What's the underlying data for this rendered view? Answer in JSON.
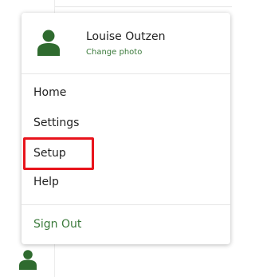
{
  "profile": {
    "name": "Louise Outzen",
    "change_photo": "Change photo"
  },
  "menu": {
    "home": "Home",
    "settings": "Settings",
    "setup": "Setup",
    "help": "Help",
    "sign_out": "Sign Out"
  },
  "colors": {
    "accent_green": "#2f6b2f",
    "link_green": "#3b7a3b",
    "highlight_red": "#e8141c"
  },
  "icons": {
    "profile_avatar": "user-icon",
    "rail_avatar": "user-icon"
  }
}
